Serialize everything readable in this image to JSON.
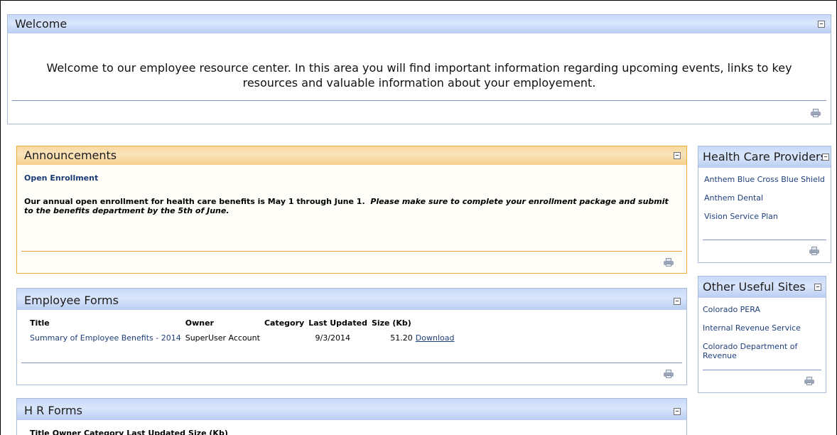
{
  "welcome": {
    "title": "Welcome",
    "text": "Welcome to our employee resource center.  In this area you will find important information regarding upcoming events, links to key resources and valuable information about your employement."
  },
  "announcements": {
    "title": "Announcements",
    "item_title": "Open Enrollment",
    "body_part1": "Our annual open enrollment for health care benefits is May 1 through June 1.",
    "body_part2": "Please make sure to complete your enrollment package and submit to the benefits department by the 5th of June."
  },
  "employee_forms": {
    "title": "Employee Forms",
    "columns": [
      "Title",
      "Owner",
      "Category",
      "Last Updated",
      "Size (Kb)"
    ],
    "rows": [
      {
        "title": "Summary of Employee Benefits - 2014",
        "owner": "SuperUser Account",
        "category": "",
        "last_updated": "9/3/2014",
        "size": "51.20",
        "action": "Download"
      }
    ]
  },
  "hr_forms": {
    "title": "H R Forms",
    "columns": [
      "Title",
      "Owner",
      "Category",
      "Last Updated",
      "Size (Kb)"
    ]
  },
  "health_care": {
    "title": "Health Care Providers",
    "links": [
      "Anthem Blue Cross Blue Shield",
      "Anthem Dental",
      "Vision Service Plan"
    ]
  },
  "useful_sites": {
    "title": "Other Useful Sites",
    "links": [
      "Colorado PERA",
      "Internal Revenue Service",
      "Colorado Department of Revenue"
    ]
  },
  "colors": {
    "blue_header": "#c8d8f8",
    "orange_header": "#f9d9a3",
    "link": "#1f3f7c"
  }
}
